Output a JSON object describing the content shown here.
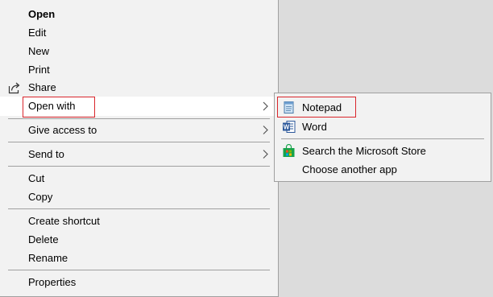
{
  "context_menu": {
    "items": [
      {
        "label": "Open"
      },
      {
        "label": "Edit"
      },
      {
        "label": "New"
      },
      {
        "label": "Print"
      },
      {
        "label": "Share"
      },
      {
        "label": "Open with"
      },
      {
        "label": "Give access to"
      },
      {
        "label": "Send to"
      },
      {
        "label": "Cut"
      },
      {
        "label": "Copy"
      },
      {
        "label": "Create shortcut"
      },
      {
        "label": "Delete"
      },
      {
        "label": "Rename"
      },
      {
        "label": "Properties"
      }
    ]
  },
  "open_with_submenu": {
    "items": [
      {
        "label": "Notepad",
        "icon": "notepad-icon"
      },
      {
        "label": "Word",
        "icon": "word-icon",
        "icon_letter": "W"
      },
      {
        "label": "Search the Microsoft Store",
        "icon": "store-icon"
      },
      {
        "label": "Choose another app"
      }
    ]
  },
  "colors": {
    "menu_background": "#f2f2f2",
    "hover_background": "#ffffff",
    "highlight_border": "#d9262c",
    "word_blue": "#2b579a",
    "store_green": "#16a34a"
  }
}
